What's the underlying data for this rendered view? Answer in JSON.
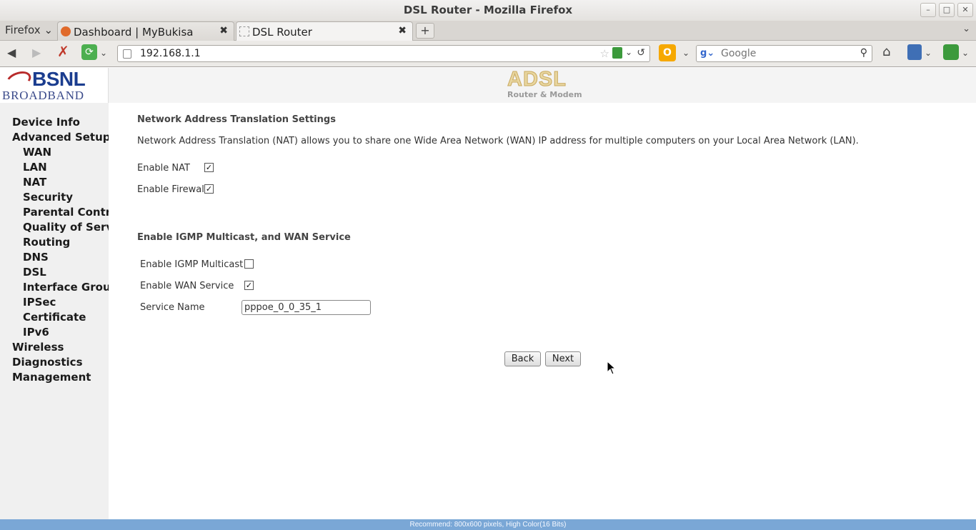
{
  "window": {
    "title": "DSL Router - Mozilla Firefox"
  },
  "tabs": {
    "firefox_menu": "Firefox",
    "items": [
      {
        "label": "Dashboard | MyBukisa"
      },
      {
        "label": "DSL Router"
      }
    ]
  },
  "nav": {
    "url": "192.168.1.1",
    "search_placeholder": "Google"
  },
  "header": {
    "logo_top": "BSNL",
    "logo_bottom": "BROADBAND",
    "banner_title": "ADSL",
    "banner_sub": "Router & Modem"
  },
  "sidebar": {
    "items": [
      {
        "label": "Device Info"
      },
      {
        "label": "Advanced Setup"
      },
      {
        "label": "WAN"
      },
      {
        "label": "LAN"
      },
      {
        "label": "NAT"
      },
      {
        "label": "Security"
      },
      {
        "label": "Parental Control"
      },
      {
        "label": "Quality of Service"
      },
      {
        "label": "Routing"
      },
      {
        "label": "DNS"
      },
      {
        "label": "DSL"
      },
      {
        "label": "Interface Grouping"
      },
      {
        "label": "IPSec"
      },
      {
        "label": "Certificate"
      },
      {
        "label": "IPv6"
      },
      {
        "label": "Wireless"
      },
      {
        "label": "Diagnostics"
      },
      {
        "label": "Management"
      }
    ]
  },
  "content": {
    "nat_heading": "Network Address Translation Settings",
    "nat_description": "Network Address Translation (NAT) allows you to share one Wide Area Network (WAN) IP address for multiple computers on your Local Area Network (LAN).",
    "enable_nat_label": "Enable NAT",
    "enable_nat_checked": true,
    "enable_firewall_label": "Enable Firewall",
    "enable_firewall_checked": true,
    "igmp_heading": "Enable IGMP Multicast, and WAN Service",
    "igmp_label": "Enable IGMP Multicast",
    "igmp_checked": false,
    "wan_service_label": "Enable WAN Service",
    "wan_service_checked": true,
    "service_name_label": "Service Name",
    "service_name_value": "pppoe_0_0_35_1",
    "back_label": "Back",
    "next_label": "Next"
  },
  "statusbar": {
    "text": "Recommend: 800x600 pixels, High Color(16 Bits)"
  }
}
